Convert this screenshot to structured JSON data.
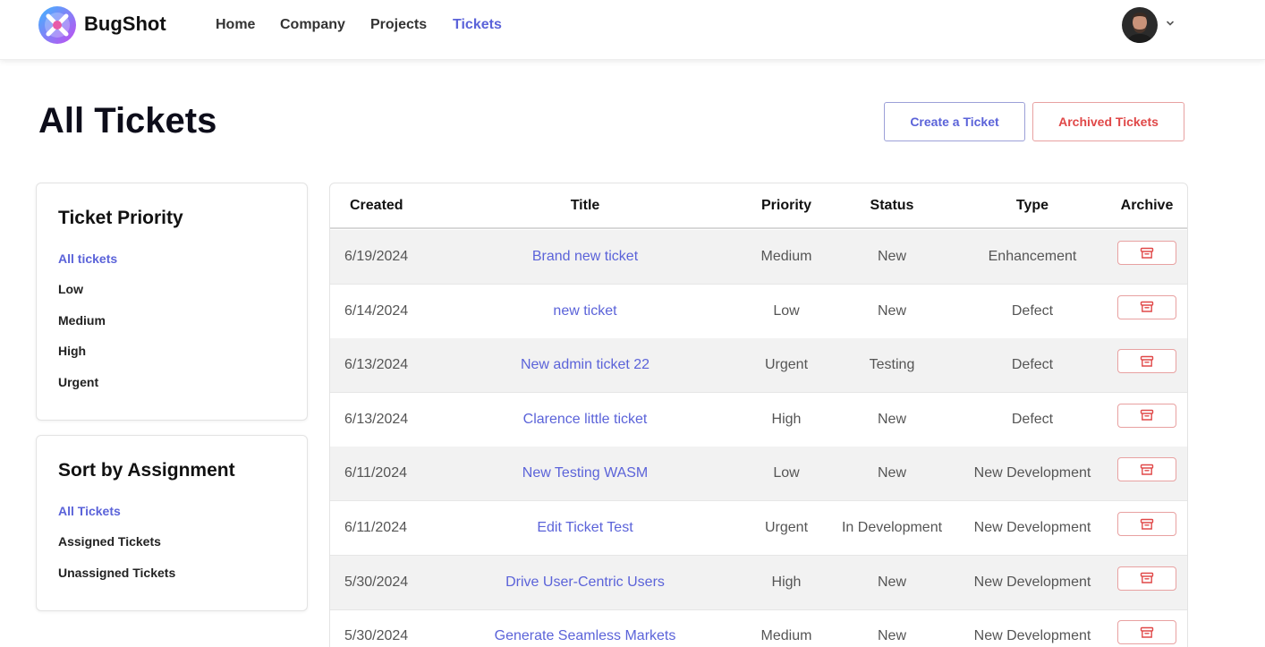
{
  "navbar": {
    "brand": "BugShot",
    "links": [
      {
        "label": "Home",
        "active": false
      },
      {
        "label": "Company",
        "active": false
      },
      {
        "label": "Projects",
        "active": false
      },
      {
        "label": "Tickets",
        "active": true
      }
    ],
    "accent_color": "#5b63d9"
  },
  "header": {
    "title": "All Tickets",
    "create_button": "Create a Ticket",
    "archived_button": "Archived Tickets"
  },
  "priority_filter": {
    "title": "Ticket Priority",
    "items": [
      "All tickets",
      "Low",
      "Medium",
      "High",
      "Urgent"
    ],
    "active_index": 0
  },
  "assignment_filter": {
    "title": "Sort by Assignment",
    "items": [
      "All Tickets",
      "Assigned Tickets",
      "Unassigned Tickets"
    ],
    "active_index": 0
  },
  "table": {
    "columns": [
      "Created",
      "Title",
      "Priority",
      "Status",
      "Type",
      "Archive"
    ],
    "archive_icon": "archive-box-icon",
    "rows": [
      {
        "created": "6/19/2024",
        "title": "Brand new ticket",
        "priority": "Medium",
        "status": "New",
        "type": "Enhancement"
      },
      {
        "created": "6/14/2024",
        "title": "new ticket",
        "priority": "Low",
        "status": "New",
        "type": "Defect"
      },
      {
        "created": "6/13/2024",
        "title": "New admin ticket 22",
        "priority": "Urgent",
        "status": "Testing",
        "type": "Defect"
      },
      {
        "created": "6/13/2024",
        "title": "Clarence little ticket",
        "priority": "High",
        "status": "New",
        "type": "Defect"
      },
      {
        "created": "6/11/2024",
        "title": "New Testing WASM",
        "priority": "Low",
        "status": "New",
        "type": "New Development"
      },
      {
        "created": "6/11/2024",
        "title": "Edit Ticket Test",
        "priority": "Urgent",
        "status": "In Development",
        "type": "New Development"
      },
      {
        "created": "5/30/2024",
        "title": "Drive User-Centric Users",
        "priority": "High",
        "status": "New",
        "type": "New Development"
      },
      {
        "created": "5/30/2024",
        "title": "Generate Seamless Markets",
        "priority": "Medium",
        "status": "New",
        "type": "New Development"
      }
    ]
  }
}
